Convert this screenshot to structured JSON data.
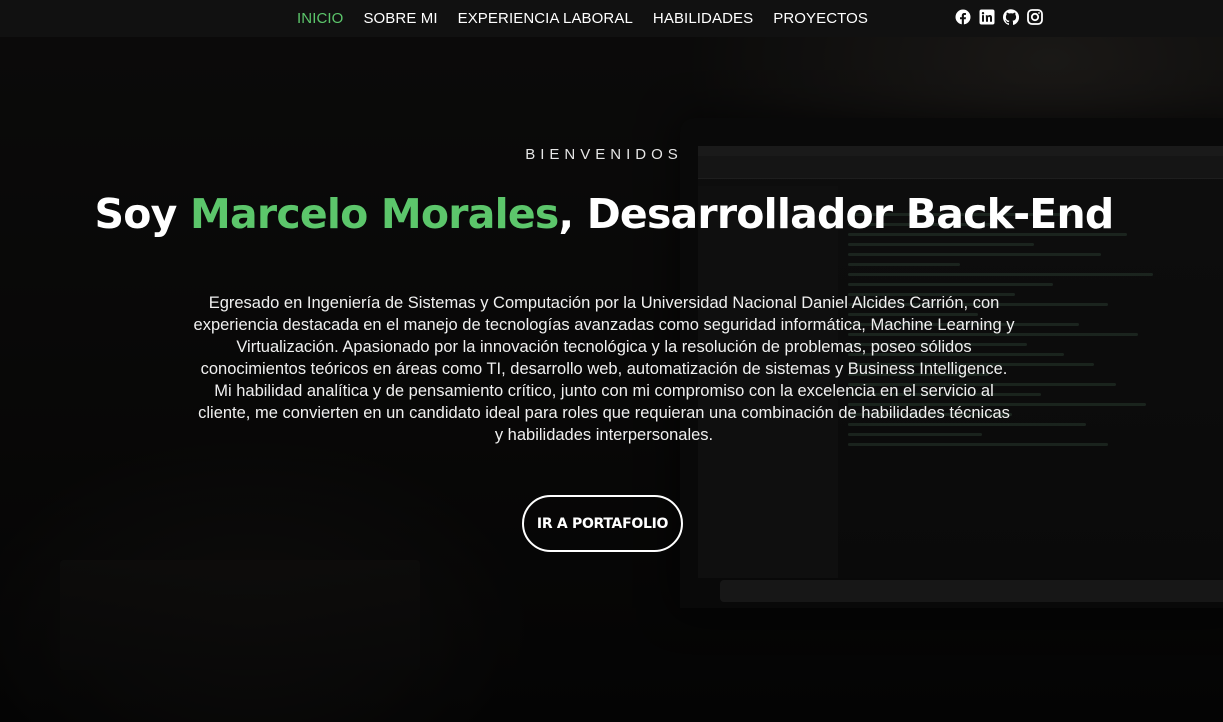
{
  "nav": {
    "items": [
      {
        "label": "INICIO",
        "active": true
      },
      {
        "label": "SOBRE MI",
        "active": false
      },
      {
        "label": "EXPERIENCIA LABORAL",
        "active": false
      },
      {
        "label": "HABILIDADES",
        "active": false
      },
      {
        "label": "PROYECTOS",
        "active": false
      }
    ],
    "social": [
      "facebook-icon",
      "linkedin-icon",
      "github-icon",
      "instagram-icon"
    ]
  },
  "hero": {
    "eyebrow": "BIENVENIDOS",
    "headline_prefix": "Soy ",
    "headline_name": "Marcelo Morales",
    "headline_suffix": ", Desarrollador Back-End",
    "intro": "Egresado en Ingeniería de Sistemas y Computación por la Universidad Nacional Daniel Alcides Carrión, con experiencia destacada en el manejo de tecnologías avanzadas como seguridad informática, Machine Learning y Virtualización. Apasionado por la innovación tecnológica y la resolución de problemas, poseo sólidos conocimientos teóricos en áreas como TI, desarrollo web, automatización de sistemas y Business Intelligence. Mi habilidad analítica y de pensamiento crítico, junto con mi compromiso con la excelencia en el servicio al cliente, me convierten en un candidato ideal para roles que requieran una combinación de habilidades técnicas y habilidades interpersonales.",
    "cta_label": "IR A PORTAFOLIO"
  },
  "colors": {
    "accent": "#5cc66b",
    "navbar_bg": "#111111",
    "text": "#ffffff"
  }
}
